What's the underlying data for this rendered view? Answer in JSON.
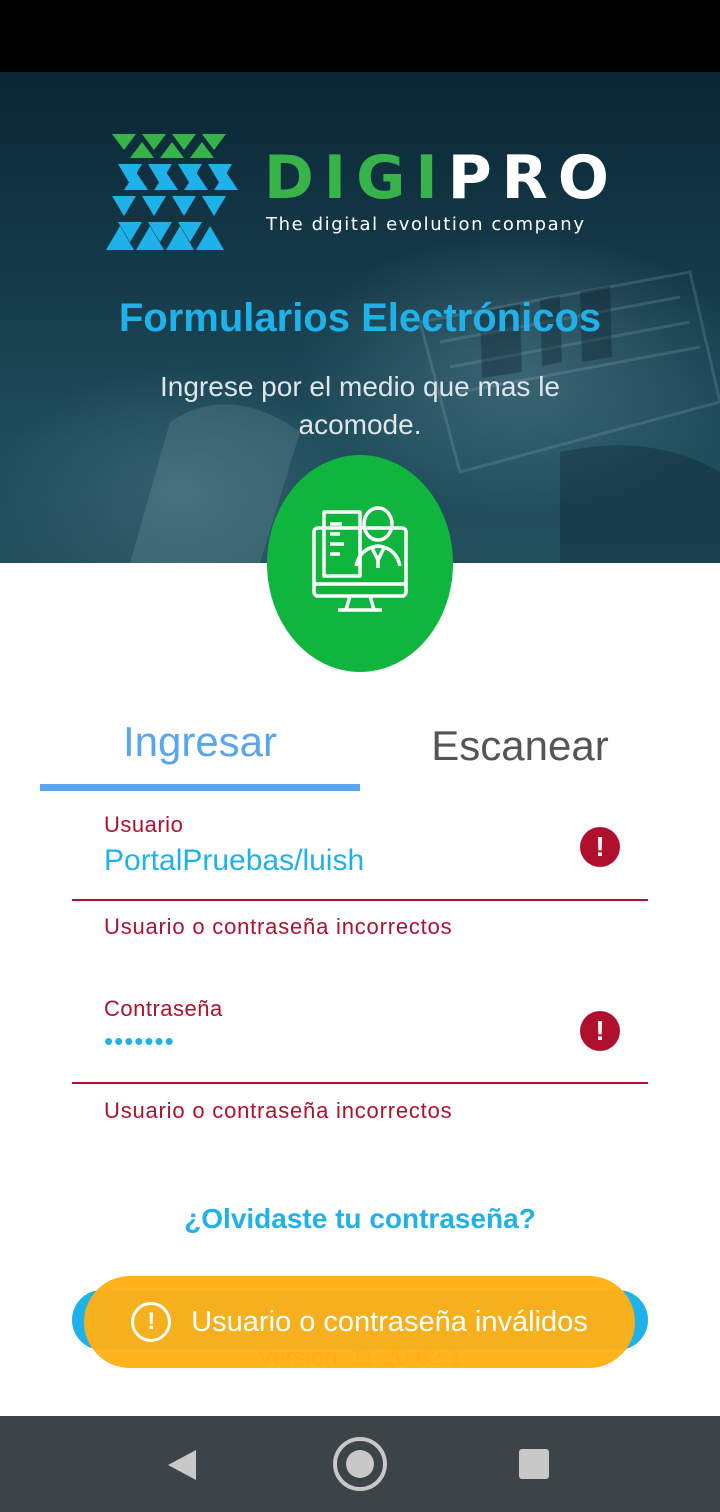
{
  "brand": {
    "name_left": "DIGI",
    "name_right": "PRO",
    "tagline": "The digital evolution company"
  },
  "header": {
    "title": "Formularios Electrónicos",
    "subtitle": "Ingrese por el medio que mas le acomode."
  },
  "tabs": {
    "login": "Ingresar",
    "scan": "Escanear"
  },
  "form": {
    "user_label": "Usuario",
    "user_value": "PortalPruebas/luish",
    "user_error": "Usuario o contraseña incorrectos",
    "password_label": "Contraseña",
    "password_value": "•••••••",
    "password_error": "Usuario o contraseña incorrectos",
    "forgot_link": "¿Olvidaste tu contraseña?"
  },
  "footer": {
    "version": "Versión: 11.20.62.1"
  },
  "toast": {
    "message": "Usuario o contraseña inválidos"
  },
  "colors": {
    "accent": "#1fb2ea",
    "error": "#b0102d",
    "green": "#0fb53d",
    "toast": "#ffb014"
  }
}
